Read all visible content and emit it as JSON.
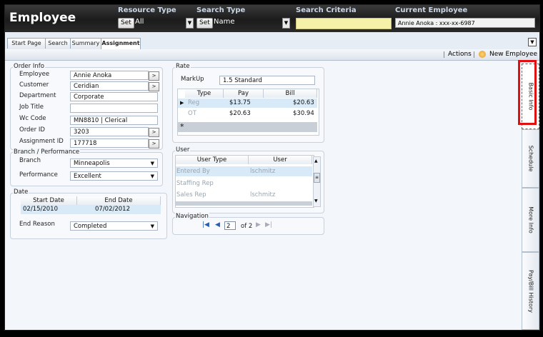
{
  "header": {
    "app_title": "Employee",
    "resource_type_label": "Resource Type",
    "resource_set": "Set",
    "resource_value": "All",
    "search_type_label": "Search Type",
    "search_set": "Set",
    "search_value": "Name",
    "search_criteria_label": "Search Criteria",
    "current_employee_label": "Current Employee",
    "current_employee_value": "Annie  Anoka : xxx-xx-6987"
  },
  "tabs": [
    "Start Page",
    "Search",
    "Summary",
    "Assignment"
  ],
  "toolbar": {
    "actions": "Actions",
    "new_employee": "New Employee"
  },
  "order_info": {
    "legend": "Order Info",
    "fields": [
      {
        "label": "Employee",
        "value": "Annie  Anoka",
        "button": ">"
      },
      {
        "label": "Customer",
        "value": "Ceridian",
        "button": ">"
      },
      {
        "label": "Department",
        "value": "Corporate"
      },
      {
        "label": "Job Title",
        "value": ""
      },
      {
        "label": "Wc Code",
        "value": "MN8810 | Clerical"
      },
      {
        "label": "Order ID",
        "value": "3203",
        "button": ">"
      },
      {
        "label": "Assignment ID",
        "value": "177718",
        "button": ">"
      }
    ]
  },
  "branch": {
    "legend": "Branch / Performance",
    "branch_label": "Branch",
    "branch_value": "Minneapolis",
    "performance_label": "Performance",
    "performance_value": "Excellent"
  },
  "date": {
    "legend": "Date",
    "headers": [
      "Start Date",
      "End Date"
    ],
    "row": [
      "02/15/2010",
      "07/02/2012"
    ],
    "end_reason_label": "End Reason",
    "end_reason_value": "Completed"
  },
  "rate": {
    "legend": "Rate",
    "markup_label": "MarkUp",
    "markup_value": "1.5 Standard",
    "headers": [
      "Type",
      "Pay",
      "Bill"
    ],
    "rows": [
      [
        "Reg",
        "$13.75",
        "$20.63"
      ],
      [
        "OT",
        "$20.63",
        "$30.94"
      ]
    ],
    "new_row_marker": "*"
  },
  "user": {
    "legend": "User",
    "headers": [
      "User Type",
      "User"
    ],
    "rows": [
      [
        "Entered By",
        "lschmitz"
      ],
      [
        "Staffing Rep",
        ""
      ],
      [
        "Sales Rep",
        "lschmitz"
      ]
    ]
  },
  "navigation": {
    "legend": "Navigation",
    "page": "2",
    "of_text": "of 2"
  },
  "side_tabs": [
    "Basic Info",
    "Schedule",
    "More Info",
    "Pay/Bill History"
  ],
  "colors": {
    "highlight": "#e01010",
    "selected_row": "#d8e9f7"
  }
}
